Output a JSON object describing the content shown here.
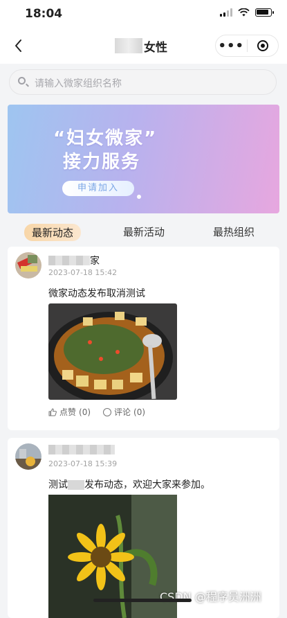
{
  "status": {
    "time": "18:04"
  },
  "nav": {
    "back_icon": "chevron-left-icon",
    "title": "女性",
    "more_icon": "more-dots-icon",
    "close_icon": "target-ring-icon"
  },
  "search": {
    "placeholder": "请输入微家组织名称",
    "icon": "search-icon"
  },
  "banner": {
    "title_line1": "“妇女微家”",
    "title_line2": "接力服务",
    "button": "申请加入"
  },
  "tabs": [
    {
      "label": "最新动态",
      "active": true
    },
    {
      "label": "最新活动",
      "active": false
    },
    {
      "label": "最热组织",
      "active": false
    }
  ],
  "posts": [
    {
      "name_suffix": "家",
      "date": "2023-07-18 15:42",
      "content": "微家动态发布取消测试",
      "like_label": "点赞",
      "like_count": "(0)",
      "comment_label": "评论",
      "comment_count": "(0)"
    },
    {
      "name_suffix": "",
      "date": "2023-07-18 15:39",
      "content_prefix": "测试",
      "content_suffix": "发布动态，欢迎大家来参加。"
    }
  ],
  "watermark": "CSDN @程序员洲洲",
  "colors": {
    "tab_active": "#f8d6a8",
    "banner_start": "#9ec5f0",
    "banner_end": "#e7a7df"
  }
}
